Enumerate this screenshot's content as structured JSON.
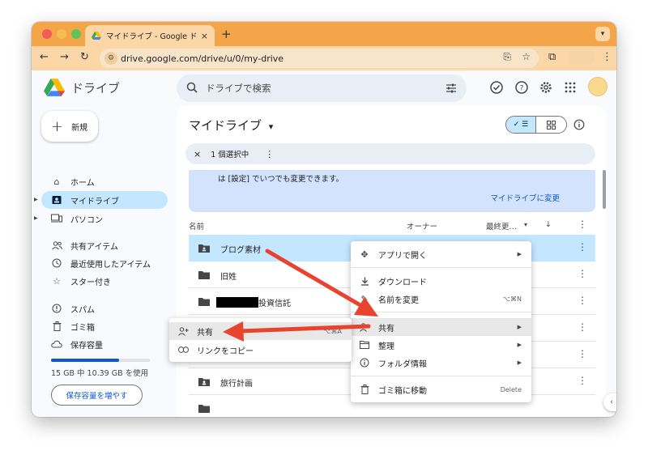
{
  "browser": {
    "tab_title": "マイドライブ - Google ドライブ",
    "tab_close": "×",
    "new_tab": "+",
    "url": "drive.google.com/drive/u/0/my-drive",
    "colors": {
      "titlebar": "#f4a54a",
      "toolbar": "#fbd6a6"
    }
  },
  "header": {
    "app_name": "ドライブ",
    "search_placeholder": "ドライブで検索"
  },
  "sidebar": {
    "new_label": "新規",
    "items": [
      {
        "label": "ホーム",
        "icon": "home-icon"
      },
      {
        "label": "マイドライブ",
        "icon": "my-drive-icon",
        "active": true
      },
      {
        "label": "パソコン",
        "icon": "computer-icon"
      },
      {
        "label": "共有アイテム",
        "icon": "shared-icon"
      },
      {
        "label": "最近使用したアイテム",
        "icon": "clock-icon"
      },
      {
        "label": "スター付き",
        "icon": "star-icon"
      },
      {
        "label": "スパム",
        "icon": "spam-icon"
      },
      {
        "label": "ゴミ箱",
        "icon": "trash-icon"
      },
      {
        "label": "保存容量",
        "icon": "cloud-icon"
      }
    ],
    "storage_text": "15 GB 中 10.39 GB を使用",
    "storage_fraction": 0.69,
    "storage_button": "保存容量を増やす"
  },
  "main": {
    "title": "マイドライブ",
    "title_caret": "▾",
    "selection_close": "×",
    "selection_text": "1 個選択中",
    "selection_more": "⋮",
    "banner_text": "は [設定] でいつでも変更できます。",
    "banner_link": "マイドライブに変更",
    "columns": {
      "name": "名前",
      "owner": "オーナー",
      "modified": "最終更…"
    },
    "rows": [
      {
        "name": "ブログ素材",
        "icon": "shared-folder-icon",
        "selected": true
      },
      {
        "name": "旧姓",
        "icon": "folder-icon"
      },
      {
        "name": "投資信託",
        "icon": "folder-icon",
        "redacted_prefix": true
      },
      {
        "name": "旅行計画",
        "icon": "shared-folder-icon"
      }
    ],
    "row_more": "⋮"
  },
  "context_menu": {
    "items": [
      {
        "label": "アプリで開く",
        "icon": "move-icon",
        "submenu": true
      },
      {
        "label": "ダウンロード",
        "icon": "download-icon"
      },
      {
        "label": "名前を変更",
        "icon": "pencil-icon",
        "shortcut": "⌥⌘N"
      },
      {
        "label": "共有",
        "icon": "person-add-icon",
        "submenu": true,
        "highlighted": true
      },
      {
        "label": "整理",
        "icon": "folder-open-icon",
        "submenu": true
      },
      {
        "label": "フォルダ情報",
        "icon": "info-icon",
        "submenu": true
      },
      {
        "label": "ゴミ箱に移動",
        "icon": "trash-icon",
        "shortcut": "Delete"
      }
    ]
  },
  "share_submenu": {
    "items": [
      {
        "label": "共有",
        "icon": "person-add-icon",
        "shortcut": "⌥⌘A",
        "highlighted": true
      },
      {
        "label": "リンクをコピー",
        "icon": "link-icon"
      }
    ]
  },
  "annotation_color": "#e8432e"
}
